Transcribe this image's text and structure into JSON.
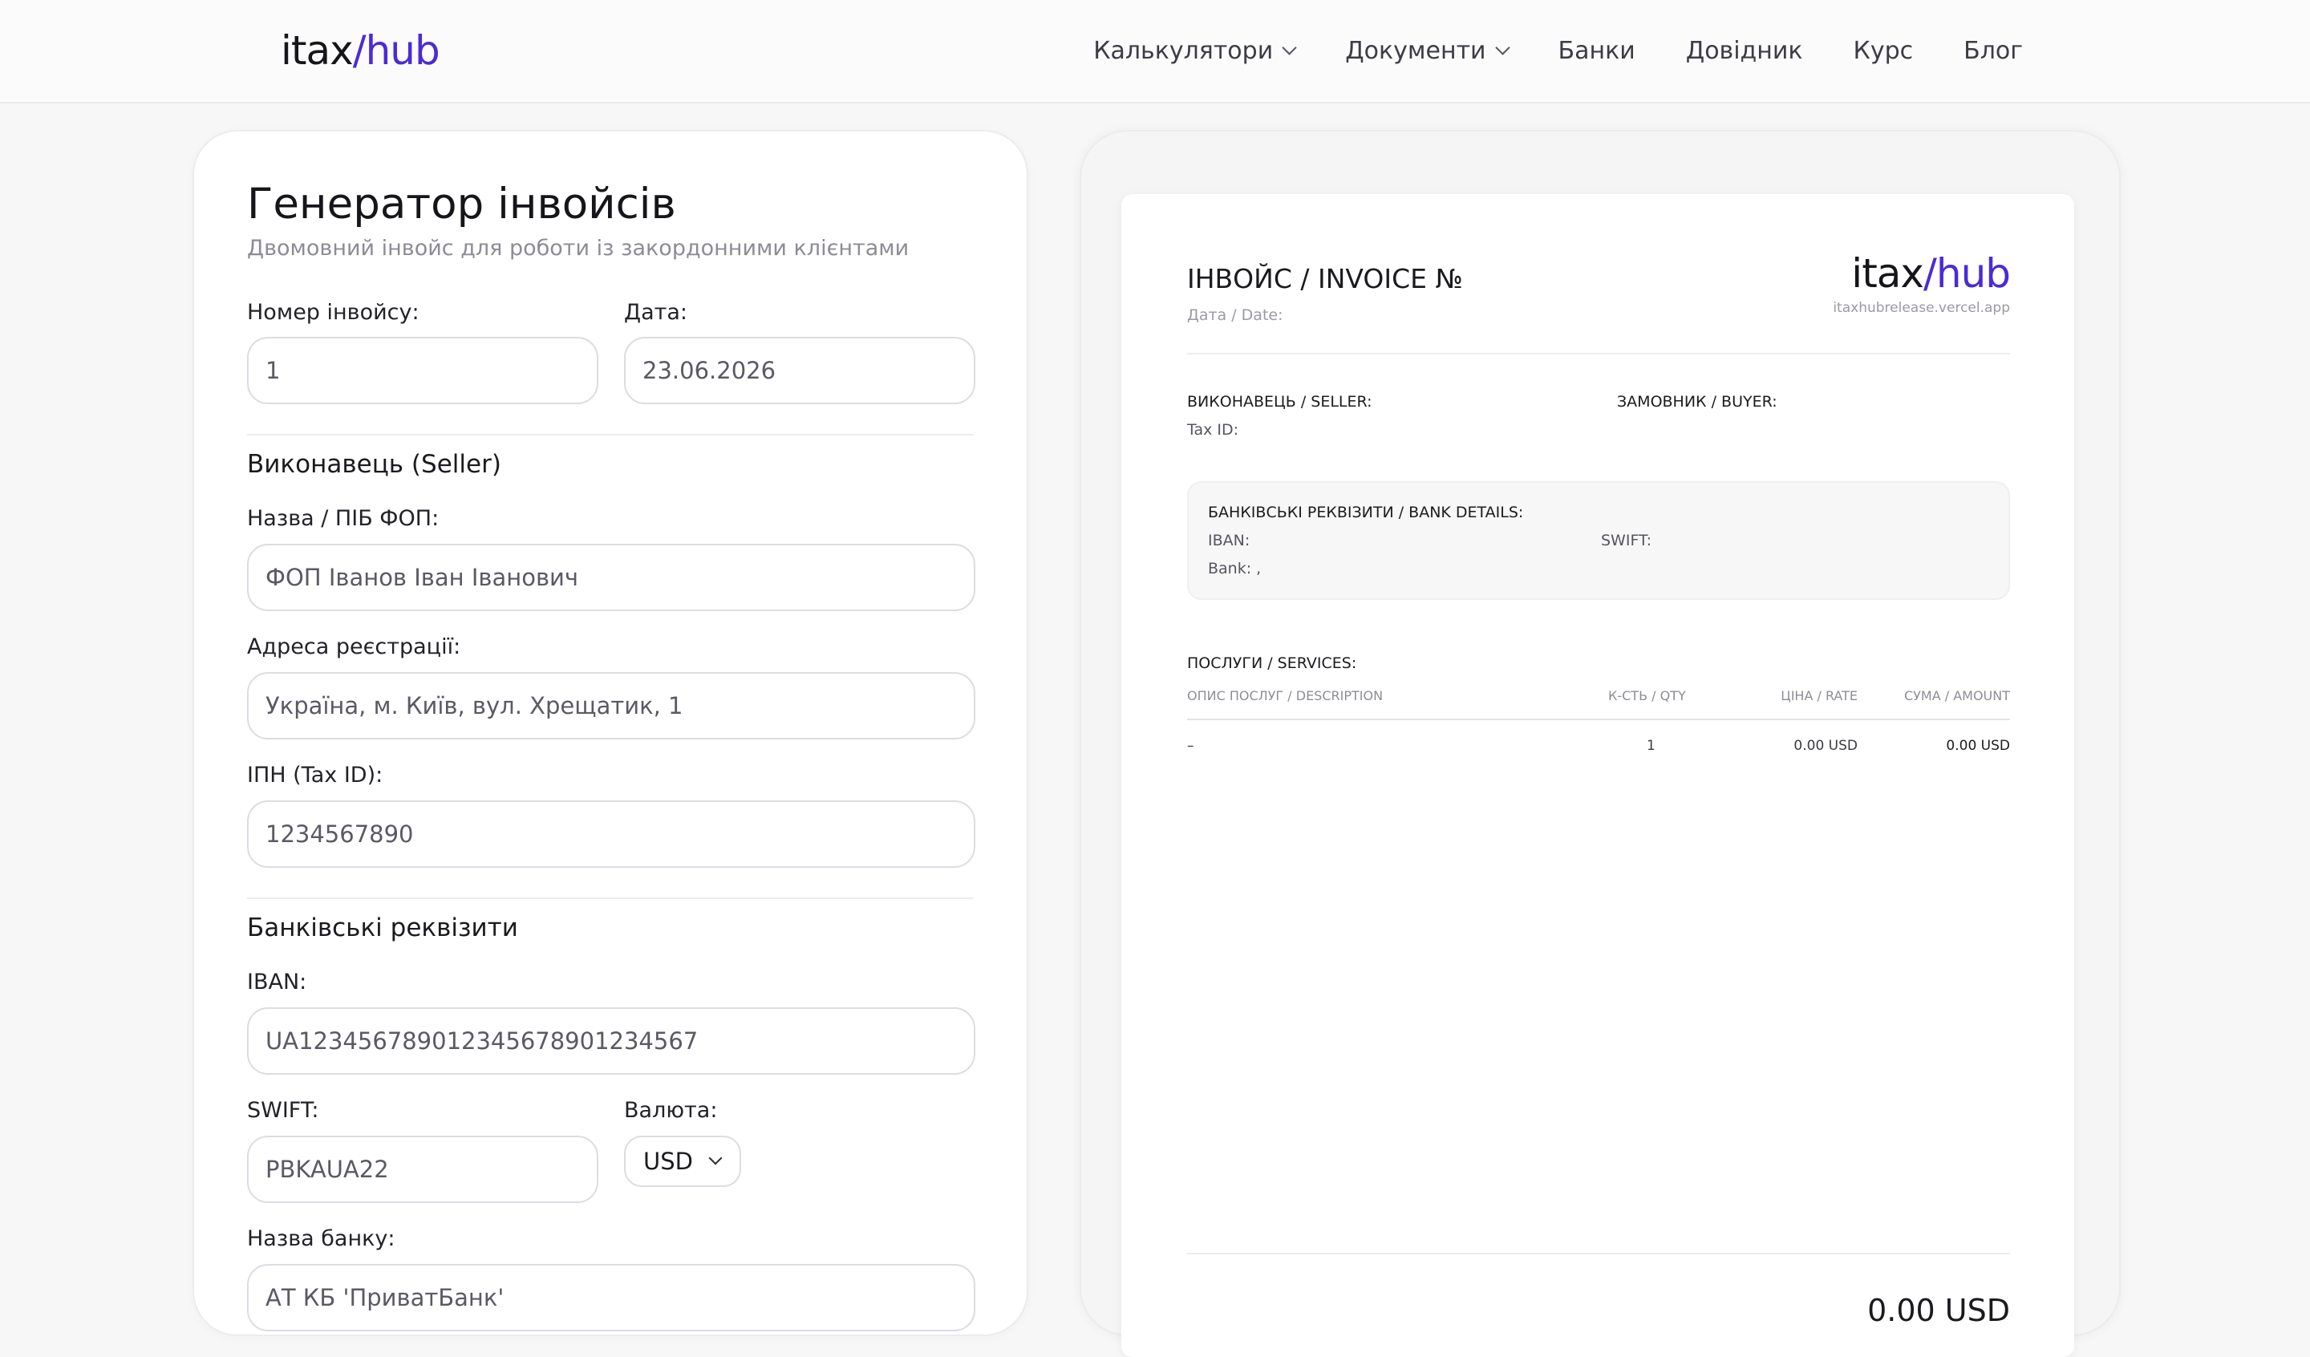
{
  "header": {
    "logo_main": "itax",
    "logo_accent": "/hub",
    "nav": [
      {
        "label": "Калькулятори",
        "dropdown": true
      },
      {
        "label": "Документи",
        "dropdown": true
      },
      {
        "label": "Банки",
        "dropdown": false
      },
      {
        "label": "Довідник",
        "dropdown": false
      },
      {
        "label": "Курс",
        "dropdown": false
      },
      {
        "label": "Блог",
        "dropdown": false
      }
    ]
  },
  "form": {
    "title": "Генератор інвойсів",
    "subtitle": "Двомовний інвойс для роботи із закордонними клієнтами",
    "invoice_number_label": "Номер інвойсу:",
    "invoice_number_value": "1",
    "date_label": "Дата:",
    "date_value": "23.06.2026",
    "seller_section": "Виконавець (Seller)",
    "name_label": "Назва / ПІБ ФОП:",
    "name_placeholder": "ФОП Іванов Іван Іванович",
    "address_label": "Адреса реєстрації:",
    "address_placeholder": "Україна, м. Київ, вул. Хрещатик, 1",
    "tax_label": "ІПН (Tax ID):",
    "tax_placeholder": "1234567890",
    "bank_section": "Банківські реквізити",
    "iban_label": "IBAN:",
    "iban_placeholder": "UA123456789012345678901234567",
    "swift_label": "SWIFT:",
    "swift_placeholder": "PBKAUA22",
    "currency_label": "Валюта:",
    "currency_value": "USD",
    "bank_name_label": "Назва банку:",
    "bank_name_placeholder": "АТ КБ 'ПриватБанк'"
  },
  "preview": {
    "title": "ІНВОЙС / INVOICE №",
    "date_label": "Дата / Date:",
    "logo_main": "itax",
    "logo_accent": "/hub",
    "url": "itaxhubrelease.vercel.app",
    "seller_label": "ВИКОНАВЕЦЬ / SELLER:",
    "tax_id_label": "Tax ID:",
    "buyer_label": "ЗАМОВНИК / BUYER:",
    "bank_details_label": "БАНКІВСЬКІ РЕКВІЗИТИ / BANK DETAILS:",
    "iban_label": "IBAN:",
    "swift_label": "SWIFT:",
    "bank_label": "Bank: ,",
    "services_label": "ПОСЛУГИ / SERVICES:",
    "columns": [
      "ОПИС ПОСЛУГ / DESCRIPTION",
      "К-СТЬ / QTY",
      "ЦІНА / RATE",
      "СУМА / AMOUNT"
    ],
    "rows": [
      {
        "description": "–",
        "qty": "1",
        "rate": "0.00 USD",
        "amount": "0.00 USD"
      }
    ],
    "total": "0.00 USD"
  }
}
